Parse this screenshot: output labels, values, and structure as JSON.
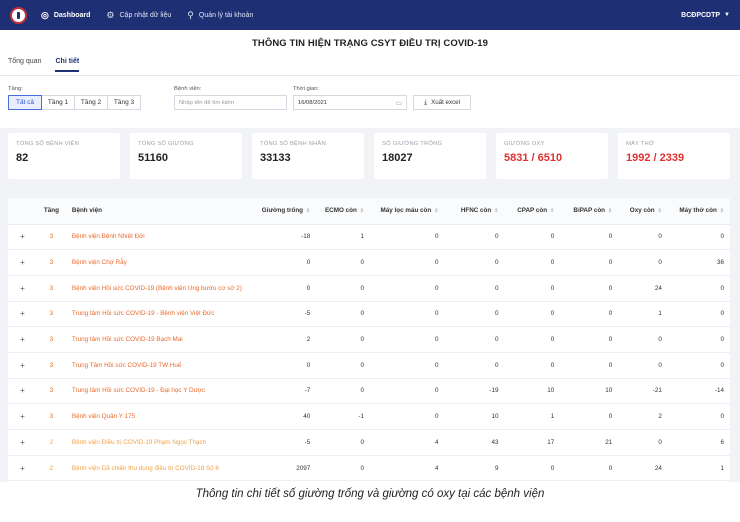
{
  "nav": {
    "items": [
      {
        "label": "Dashboard",
        "icon": "dashboard-icon"
      },
      {
        "label": "Cập nhật dữ liệu",
        "icon": "gear-icon"
      },
      {
        "label": "Quản lý tài khoản",
        "icon": "user-icon"
      }
    ],
    "user": "BCĐPCDTP"
  },
  "page": {
    "title": "THÔNG TIN HIỆN TRẠNG CSYT ĐIỀU TRỊ COVID-19",
    "tabs": [
      "Tổng quan",
      "Chi tiết"
    ]
  },
  "filters": {
    "floor_label": "Tầng:",
    "floors": [
      "Tất cả",
      "Tầng 1",
      "Tầng 2",
      "Tầng 3"
    ],
    "hospital_label": "Bệnh viện:",
    "hospital_placeholder": "Nhập tên để tìm kiếm",
    "time_label": "Thời gian:",
    "date_value": "16/08/2021",
    "export_label": "Xuất excel"
  },
  "cards": [
    {
      "label": "Tổng số bệnh viện",
      "value": "82",
      "red": false
    },
    {
      "label": "Tổng số giường",
      "value": "51160",
      "red": false
    },
    {
      "label": "Tổng số bệnh nhân",
      "value": "33133",
      "red": false
    },
    {
      "label": "Số giường trống",
      "value": "18027",
      "red": false
    },
    {
      "label": "Giường oxy",
      "value": "5831 / 6510",
      "red": true
    },
    {
      "label": "Máy thở",
      "value": "1992 / 2339",
      "red": true
    }
  ],
  "table": {
    "headers": [
      "Tầng",
      "Bệnh viện",
      "Giường trống",
      "ECMO còn",
      "Máy lọc máu còn",
      "HFNC còn",
      "CPAP còn",
      "BiPAP còn",
      "Oxy còn",
      "Máy thở còn"
    ],
    "rows": [
      [
        "3",
        "Bệnh viện Bệnh Nhiệt Đới",
        "-18",
        "1",
        "0",
        "0",
        "0",
        "0",
        "0",
        "0"
      ],
      [
        "3",
        "Bệnh viện Chợ Rẫy",
        "0",
        "0",
        "0",
        "0",
        "0",
        "0",
        "0",
        "36"
      ],
      [
        "3",
        "Bệnh viện Hồi sức COVID-19 (Bệnh viện Ung bướu cơ sở 2)",
        "0",
        "0",
        "0",
        "0",
        "0",
        "0",
        "24",
        "0"
      ],
      [
        "3",
        "Trung tâm Hồi sức COVID-19 - Bệnh viện Việt Đức",
        "-5",
        "0",
        "0",
        "0",
        "0",
        "0",
        "1",
        "0"
      ],
      [
        "3",
        "Trung tâm Hồi sức COVID-19 Bạch Mai",
        "2",
        "0",
        "0",
        "0",
        "0",
        "0",
        "0",
        "0"
      ],
      [
        "3",
        "Trung Tâm Hồi sức COVID-19 TW Huế",
        "0",
        "0",
        "0",
        "0",
        "0",
        "0",
        "0",
        "0"
      ],
      [
        "3",
        "Trung tâm Hồi sức COVID-19 - Đại học Y Dược",
        "-7",
        "0",
        "0",
        "-19",
        "10",
        "10",
        "-21",
        "-14"
      ],
      [
        "3",
        "Bệnh viện Quân Y 175",
        "40",
        "-1",
        "0",
        "10",
        "1",
        "0",
        "2",
        "0"
      ],
      [
        "2",
        "Bệnh viện Điều trị COVID-19 Phạm Ngọc Thạch",
        "-5",
        "0",
        "4",
        "43",
        "17",
        "21",
        "0",
        "6"
      ],
      [
        "2",
        "Bệnh viện Dã chiến thu dung điều trị COVID-19 Số 6",
        "2097",
        "0",
        "4",
        "9",
        "0",
        "0",
        "24",
        "1"
      ]
    ]
  },
  "caption": "Thông tin chi tiết số giường trống và giường có oxy tại các bệnh viện",
  "colors": {
    "navbar": "#1f2f74",
    "accent": "#2f55d4",
    "link": "#e86a2c",
    "alert": "#e0312f"
  }
}
